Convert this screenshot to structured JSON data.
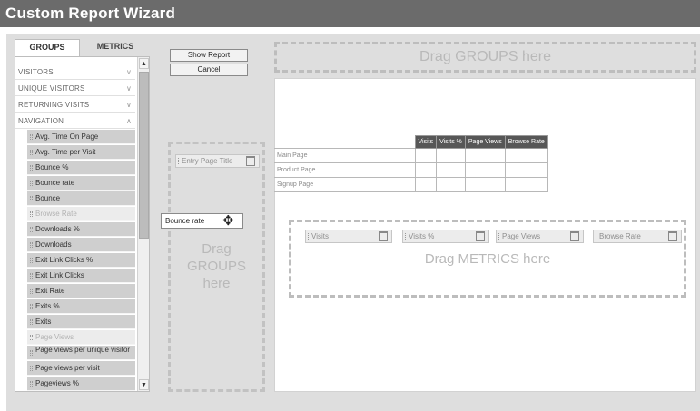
{
  "window": {
    "title": "Custom Report Wizard"
  },
  "tabs": [
    {
      "label": "GROUPS",
      "active": true
    },
    {
      "label": "METRICS",
      "active": false
    }
  ],
  "groups": [
    {
      "label": "VISITORS",
      "chevron": "chevron-down-icon"
    },
    {
      "label": "UNIQUE VISITORS",
      "chevron": "chevron-down-icon"
    },
    {
      "label": "RETURNING VISITS",
      "chevron": "chevron-down-icon"
    },
    {
      "label": "NAVIGATION",
      "chevron": "chevron-up-icon"
    }
  ],
  "metrics": [
    {
      "label": "Avg. Time On Page"
    },
    {
      "label": "Avg. Time per Visit"
    },
    {
      "label": "Bounce %"
    },
    {
      "label": "Bounce rate"
    },
    {
      "label": "Bounce"
    },
    {
      "label": "Browse Rate",
      "disabled": true
    },
    {
      "label": "Downloads %"
    },
    {
      "label": "Downloads"
    },
    {
      "label": "Exit Link Clicks %"
    },
    {
      "label": "Exit Link Clicks"
    },
    {
      "label": "Exit Rate"
    },
    {
      "label": "Exits %"
    },
    {
      "label": "Exits"
    },
    {
      "label": "Page Views",
      "disabled": true
    },
    {
      "label": "Page views per unique visitor"
    },
    {
      "label": "Page views per visit"
    },
    {
      "label": "Pageviews %"
    }
  ],
  "buttons": {
    "show_report": "Show Report",
    "cancel": "Cancel"
  },
  "group_drop": {
    "chip": "Entry Page Title",
    "placeholder": "Drag GROUPS here"
  },
  "dragging": {
    "label": "Bounce rate",
    "icon": "move-cursor-icon"
  },
  "report": {
    "columns": [
      "Visits",
      "Visits %",
      "Page Views",
      "Browse Rate"
    ],
    "rows": [
      {
        "label": "Main Page"
      },
      {
        "label": "Product Page"
      },
      {
        "label": "Signup Page"
      }
    ]
  },
  "metric_drop": {
    "chips": [
      "Visits",
      "Visits %",
      "Page Views",
      "Browse Rate"
    ],
    "placeholder": "Drag METRICS here"
  },
  "top_drop": {
    "placeholder": "Drag GROUPS here"
  }
}
